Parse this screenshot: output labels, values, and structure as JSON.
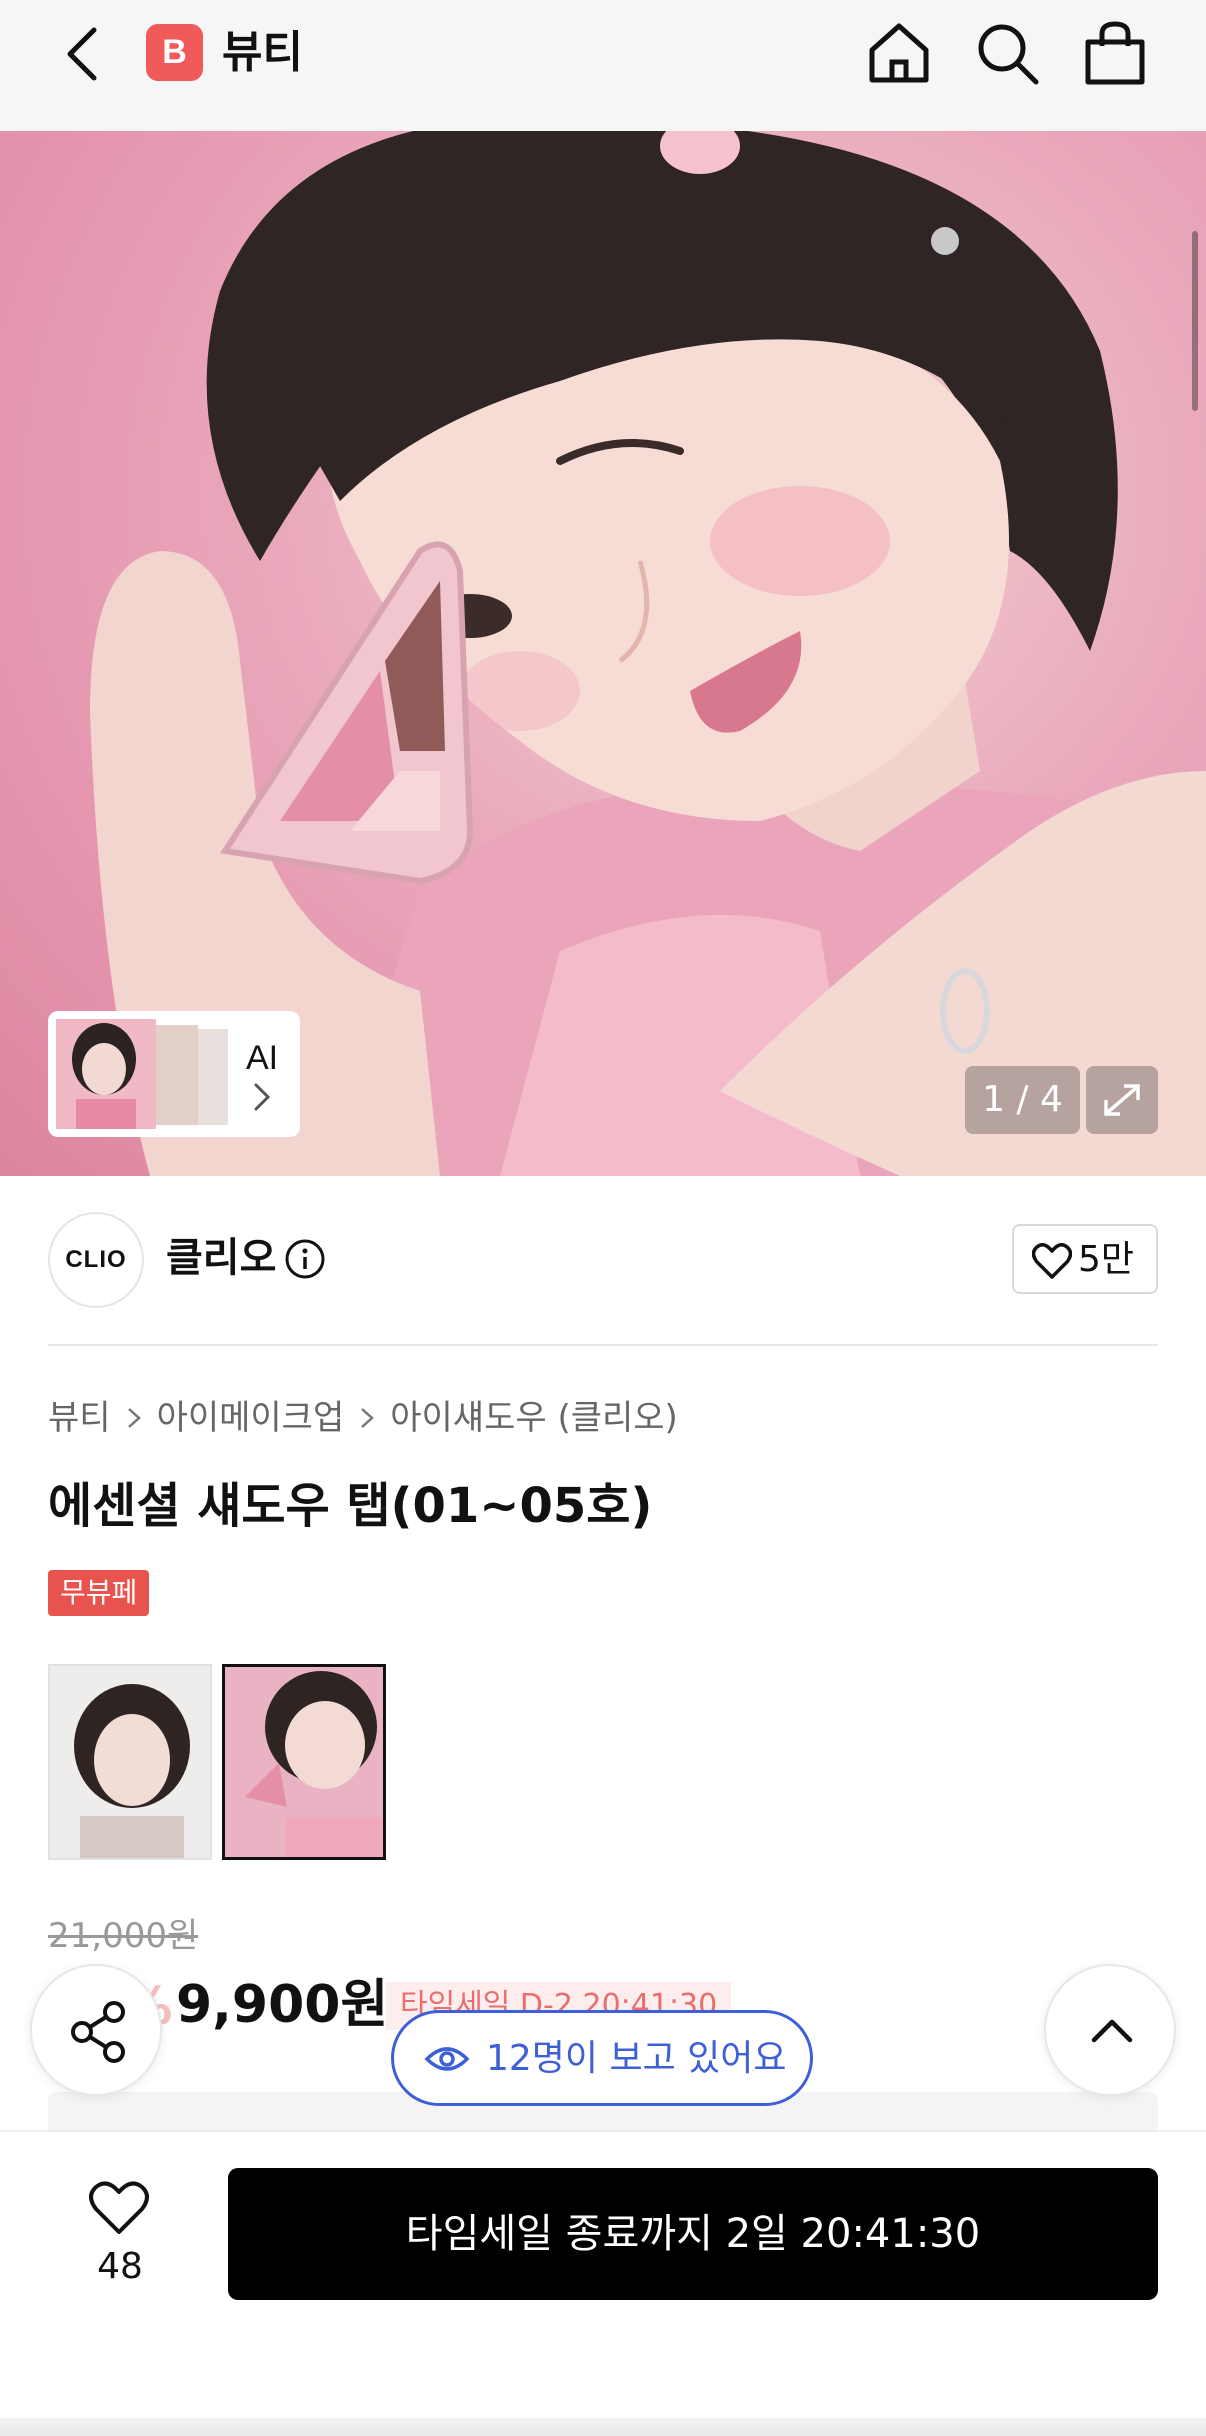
{
  "header": {
    "brand_logo_letter": "B",
    "title": "뷰티",
    "icons": [
      "back-icon",
      "home-icon",
      "search-icon",
      "shopping-bag-icon"
    ]
  },
  "gallery": {
    "ai_label": "AI",
    "counter": "1 / 4",
    "colors": {
      "background_pink": "#e9a8bb"
    }
  },
  "brand": {
    "logo_text": "CLIO",
    "name": "클리오",
    "likes": "5만"
  },
  "product": {
    "breadcrumb": [
      "뷰티",
      "아이메이크업",
      "아이섀도우 (클리오)"
    ],
    "title": "에센셜 섀도우 탭(01~05호)",
    "badge": "무뷰페",
    "original_price": "21,000원",
    "discount": "53%",
    "sale_price": "9,900원",
    "timesale_tag": "타임세일 D-2 20:41:30"
  },
  "floating": {
    "viewers": "12명이 보고 있어요"
  },
  "bottom_bar": {
    "wish_count": "48",
    "buy_button": "타임세일 종료까지 2일 20:41:30"
  },
  "colors": {
    "accent_red": "#e8534d",
    "accent_blue": "#3d5fd8",
    "button_black": "#000000"
  }
}
